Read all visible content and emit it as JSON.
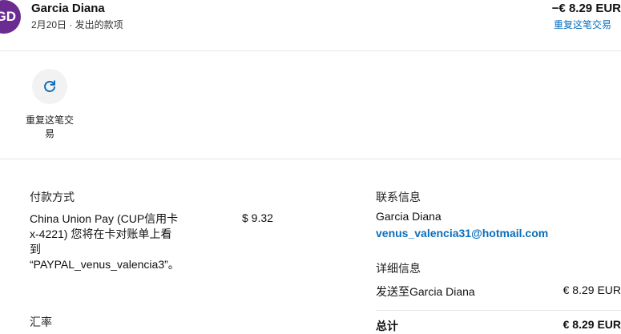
{
  "header": {
    "avatar_initials": "GD",
    "avatar_color": "#6b2c91",
    "merchant_name": "Garcia Diana",
    "subtitle": "2月20日 · 发出的款项",
    "amount": "−€ 8.29 EUR",
    "repeat_link": "重复这笔交易"
  },
  "actions": {
    "repeat_label": "重复这笔交易",
    "repeat_icon": "refresh-icon"
  },
  "payment": {
    "title": "付款方式",
    "method_text": "China Union Pay (CUP信用卡x-4221) 您将在卡对账单上看到 “PAYPAL_venus_valencia3”。",
    "amount": "$ 9.32"
  },
  "fx": {
    "title": "汇率"
  },
  "contact": {
    "title": "联系信息",
    "name": "Garcia Diana",
    "email": "venus_valencia31@hotmail.com"
  },
  "details": {
    "title": "详细信息",
    "sent_label": "发送至Garcia Diana",
    "sent_value": "€ 8.29 EUR",
    "total_label": "总计",
    "total_value": "€ 8.29 EUR"
  },
  "colors": {
    "link": "#0a6ebd",
    "divider": "#e5e5e5"
  }
}
